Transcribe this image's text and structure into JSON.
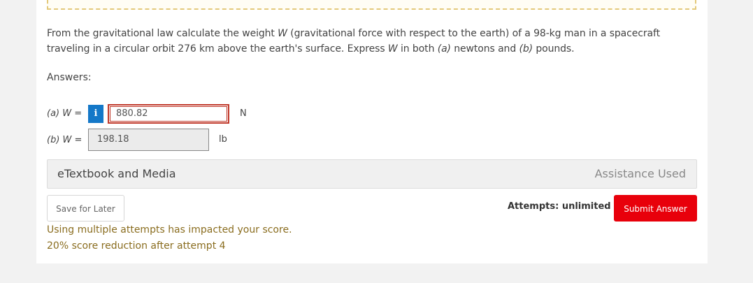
{
  "question": {
    "text_line1_a": "From the gravitational law calculate the weight ",
    "text_line1_var": "W",
    "text_line1_b": " (gravitational force with respect to the earth) of a 98-kg man in a spacecraft",
    "text_line2_a": "traveling in a circular orbit 276 km above the earth's surface. Express ",
    "text_line2_var": "W",
    "text_line2_b": " in both ",
    "text_line2_pa": "(a)",
    "text_line2_c": " newtons and ",
    "text_line2_pb": "(b)",
    "text_line2_d": " pounds."
  },
  "answers": {
    "label": "Answers:",
    "part_a": {
      "label_part": "(a)",
      "label_var": " W",
      "label_eq": " =",
      "info_icon": "i",
      "value": "880.82",
      "unit": "N"
    },
    "part_b": {
      "label_part": "(b)",
      "label_var": " W",
      "label_eq": " =",
      "value": "198.18",
      "unit": "lb"
    }
  },
  "etextbook": {
    "label": "eTextbook and Media",
    "assistance": "Assistance Used"
  },
  "actions": {
    "save_label": "Save for Later",
    "attempts_label": "Attempts: unlimited",
    "submit_label": "Submit Answer"
  },
  "notice": {
    "line1": "Using multiple attempts has impacted your score.",
    "line2": "20% score reduction after attempt 4"
  },
  "colors": {
    "submit": "#e8000b",
    "info": "#1478c8",
    "error_border": "#c0392b",
    "notice_text": "#8a6d1f"
  }
}
